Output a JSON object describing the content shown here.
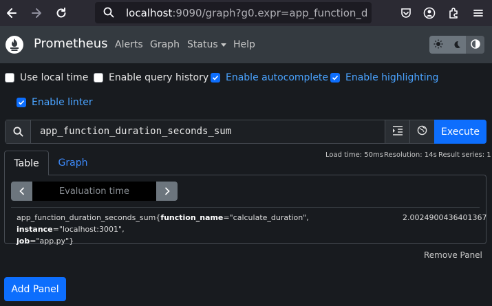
{
  "browser": {
    "url_host": "localhost",
    "url_rest": ":9090/graph?g0.expr=app_function_duration"
  },
  "navbar": {
    "brand": "Prometheus",
    "links": [
      "Alerts",
      "Graph",
      "Status",
      "Help"
    ]
  },
  "options": {
    "use_local_time": "Use local time",
    "enable_query_history": "Enable query history",
    "enable_autocomplete": "Enable autocomplete",
    "enable_highlighting": "Enable highlighting",
    "enable_linter": "Enable linter"
  },
  "query": {
    "expression": "app_function_duration_seconds_sum",
    "execute_label": "Execute"
  },
  "stats": {
    "load_time": "Load time: 50ms",
    "resolution": "Resolution: 14s",
    "result_series": "Result series: 1"
  },
  "tabs": {
    "table": "Table",
    "graph": "Graph"
  },
  "eval": {
    "placeholder": "Evaluation time"
  },
  "result": {
    "metric": "app_function_duration_seconds_sum",
    "label1_name": "function_name",
    "label1_value": "\"calculate_duration\"",
    "label2_name": "instance",
    "label2_value": "\"localhost:3001\"",
    "label3_name": "job",
    "label3_value": "\"app.py\"",
    "value": "2.0024900436401367"
  },
  "actions": {
    "remove_panel": "Remove Panel",
    "add_panel": "Add Panel"
  },
  "colors": {
    "accent": "#0d6efd",
    "link": "#3d8bfd",
    "navbar": "#343a40",
    "background": "#181b1f"
  }
}
